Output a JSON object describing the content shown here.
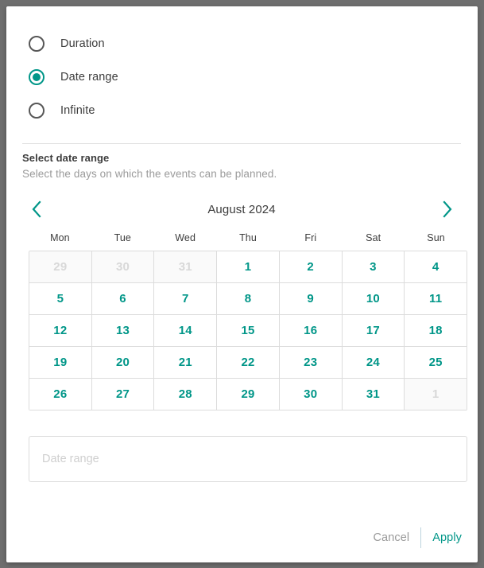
{
  "accent_color": "#009688",
  "disabled_color": "#d8d8d8",
  "muted_color": "#9a9a9a",
  "mode_options": [
    {
      "label": "Duration",
      "selected": false
    },
    {
      "label": "Date range",
      "selected": true
    },
    {
      "label": "Infinite",
      "selected": false
    }
  ],
  "section": {
    "title": "Select date range",
    "subtitle": "Select the days on which the events can be planned."
  },
  "calendar": {
    "month_label": "August 2024",
    "prev_icon": "chevron-left-icon",
    "next_icon": "chevron-right-icon",
    "weekdays": [
      "Mon",
      "Tue",
      "Wed",
      "Thu",
      "Fri",
      "Sat",
      "Sun"
    ],
    "weeks": [
      [
        {
          "day": "29",
          "disabled": true
        },
        {
          "day": "30",
          "disabled": true
        },
        {
          "day": "31",
          "disabled": true
        },
        {
          "day": "1",
          "disabled": false
        },
        {
          "day": "2",
          "disabled": false
        },
        {
          "day": "3",
          "disabled": false
        },
        {
          "day": "4",
          "disabled": false
        }
      ],
      [
        {
          "day": "5",
          "disabled": false
        },
        {
          "day": "6",
          "disabled": false
        },
        {
          "day": "7",
          "disabled": false
        },
        {
          "day": "8",
          "disabled": false
        },
        {
          "day": "9",
          "disabled": false
        },
        {
          "day": "10",
          "disabled": false
        },
        {
          "day": "11",
          "disabled": false
        }
      ],
      [
        {
          "day": "12",
          "disabled": false
        },
        {
          "day": "13",
          "disabled": false
        },
        {
          "day": "14",
          "disabled": false
        },
        {
          "day": "15",
          "disabled": false
        },
        {
          "day": "16",
          "disabled": false
        },
        {
          "day": "17",
          "disabled": false
        },
        {
          "day": "18",
          "disabled": false
        }
      ],
      [
        {
          "day": "19",
          "disabled": false
        },
        {
          "day": "20",
          "disabled": false
        },
        {
          "day": "21",
          "disabled": false
        },
        {
          "day": "22",
          "disabled": false
        },
        {
          "day": "23",
          "disabled": false
        },
        {
          "day": "24",
          "disabled": false
        },
        {
          "day": "25",
          "disabled": false
        }
      ],
      [
        {
          "day": "26",
          "disabled": false
        },
        {
          "day": "27",
          "disabled": false
        },
        {
          "day": "28",
          "disabled": false
        },
        {
          "day": "29",
          "disabled": false
        },
        {
          "day": "30",
          "disabled": false
        },
        {
          "day": "31",
          "disabled": false
        },
        {
          "day": "1",
          "disabled": true
        }
      ]
    ]
  },
  "range_field": {
    "value": "",
    "placeholder": "Date range"
  },
  "footer": {
    "cancel_label": "Cancel",
    "apply_label": "Apply"
  }
}
